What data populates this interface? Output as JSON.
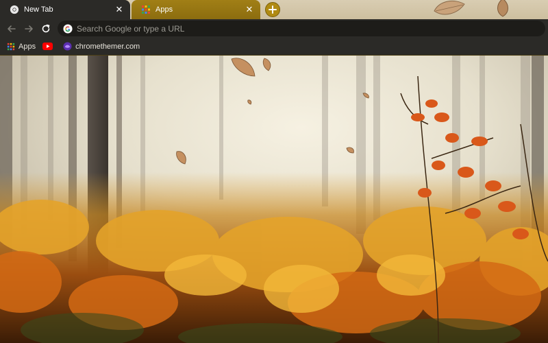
{
  "tabs": [
    {
      "title": "New Tab",
      "icon": "chrome-icon",
      "active": true
    },
    {
      "title": "Apps",
      "icon": "apps-grid-icon",
      "active": false
    }
  ],
  "toolbar": {
    "omnibox_placeholder": "Search Google or type a URL"
  },
  "bookmarks": [
    {
      "label": "Apps",
      "icon": "apps-grid-icon"
    },
    {
      "label": "",
      "icon": "youtube-icon"
    },
    {
      "label": "chromethemer.com",
      "icon": "chromethemer-icon"
    }
  ],
  "theme": {
    "frame_color": "#2b2a27",
    "tab_accent": "#a17f16",
    "background": "autumn foggy forest"
  }
}
